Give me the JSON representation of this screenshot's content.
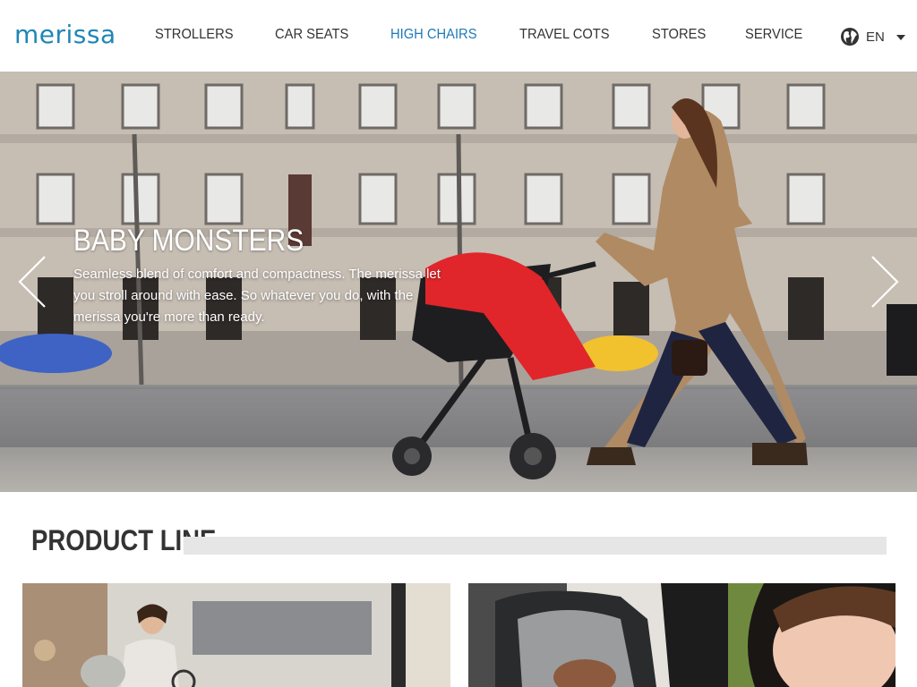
{
  "header": {
    "logo": "merissa",
    "nav": [
      {
        "label": "STROLLERS",
        "active": false
      },
      {
        "label": "CAR SEATS",
        "active": false
      },
      {
        "label": "HIGH CHAIRS",
        "active": true
      },
      {
        "label": "TRAVEL COTS",
        "active": false
      },
      {
        "label": "STORES",
        "active": false
      },
      {
        "label": "SERVICE",
        "active": false
      }
    ],
    "language": {
      "icon": "globe-icon",
      "label": "EN",
      "dropdown_icon": "caret-down-icon"
    }
  },
  "hero": {
    "title": "BABY MONSTERS",
    "text": "Seamless blend of comfort and compactness. The merissa let you stroll around with ease. So whatever you do, with the merissa you're more than ready.",
    "prev_icon": "chevron-left-icon",
    "next_icon": "chevron-right-icon"
  },
  "product_line": {
    "title": "PRODUCT LINE"
  },
  "colors": {
    "brand": "#1f86b6",
    "nav_active": "#1f7ab8",
    "text": "#333333",
    "stroller_red": "#e0262b"
  }
}
